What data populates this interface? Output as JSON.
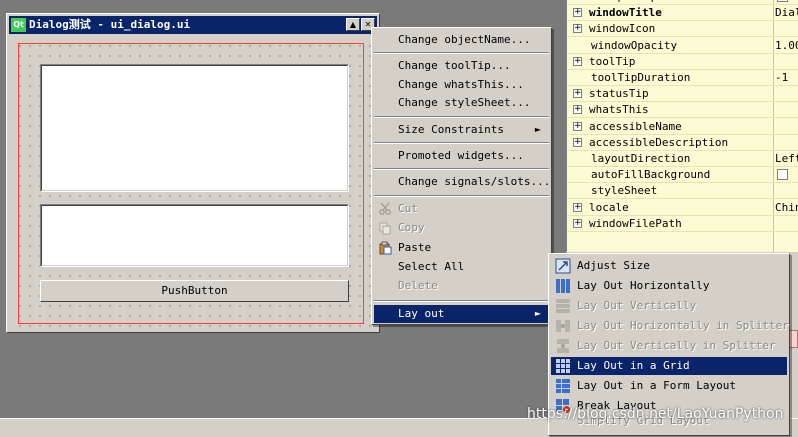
{
  "dialog": {
    "title": "Dialog测试 - ui_dialog.ui",
    "logo": "Qt",
    "minimize_glyph": "▲",
    "close_glyph": "✕",
    "push_button_label": "PushButton"
  },
  "properties": {
    "rows": [
      {
        "name": "acceptDrops",
        "value": "",
        "checkbox": true,
        "expand": false,
        "bold": false
      },
      {
        "name": "windowTitle",
        "value": "Dial",
        "checkbox": false,
        "expand": true,
        "bold": true
      },
      {
        "name": "windowIcon",
        "value": "",
        "checkbox": false,
        "expand": true,
        "bold": false
      },
      {
        "name": "windowOpacity",
        "value": "1.00",
        "checkbox": false,
        "expand": false,
        "bold": false
      },
      {
        "name": "toolTip",
        "value": "",
        "checkbox": false,
        "expand": true,
        "bold": false
      },
      {
        "name": "toolTipDuration",
        "value": "-1",
        "checkbox": false,
        "expand": false,
        "bold": false
      },
      {
        "name": "statusTip",
        "value": "",
        "checkbox": false,
        "expand": true,
        "bold": false
      },
      {
        "name": "whatsThis",
        "value": "",
        "checkbox": false,
        "expand": true,
        "bold": false
      },
      {
        "name": "accessibleName",
        "value": "",
        "checkbox": false,
        "expand": true,
        "bold": false
      },
      {
        "name": "accessibleDescription",
        "value": "",
        "checkbox": false,
        "expand": true,
        "bold": false
      },
      {
        "name": "layoutDirection",
        "value": "Left",
        "checkbox": false,
        "expand": false,
        "bold": false
      },
      {
        "name": "autoFillBackground",
        "value": "",
        "checkbox": true,
        "expand": false,
        "bold": false
      },
      {
        "name": "styleSheet",
        "value": "",
        "checkbox": false,
        "expand": false,
        "bold": false
      },
      {
        "name": "locale",
        "value": "Chin",
        "checkbox": false,
        "expand": true,
        "bold": false
      },
      {
        "name": "windowFilePath",
        "value": "",
        "checkbox": false,
        "expand": true,
        "bold": false
      }
    ]
  },
  "context_menu": {
    "items": [
      {
        "label": "Change objectName...",
        "type": "item"
      },
      {
        "type": "sep"
      },
      {
        "label": "Change toolTip...",
        "type": "item"
      },
      {
        "label": "Change whatsThis...",
        "type": "item"
      },
      {
        "label": "Change styleSheet...",
        "type": "item"
      },
      {
        "type": "sep"
      },
      {
        "label": "Size Constraints",
        "type": "item",
        "submenu": true
      },
      {
        "type": "sep"
      },
      {
        "label": "Promoted widgets...",
        "type": "item"
      },
      {
        "type": "sep"
      },
      {
        "label": "Change signals/slots...",
        "type": "item"
      },
      {
        "type": "sep"
      },
      {
        "label": "Cut",
        "type": "item",
        "disabled": true,
        "icon": "scissors-icon"
      },
      {
        "label": "Copy",
        "type": "item",
        "disabled": true,
        "icon": "copy-icon"
      },
      {
        "label": "Paste",
        "type": "item",
        "icon": "paste-icon"
      },
      {
        "label": "Select All",
        "type": "item"
      },
      {
        "label": "Delete",
        "type": "item",
        "disabled": true
      },
      {
        "type": "sep"
      },
      {
        "label": "Lay out",
        "type": "item",
        "submenu": true,
        "selected": true
      }
    ],
    "submenu_arrow": "►"
  },
  "layout_submenu": {
    "items": [
      {
        "label": "Adjust Size",
        "icon": "adjust-size-icon"
      },
      {
        "label": "Lay Out Horizontally",
        "icon": "layout-horizontal-icon"
      },
      {
        "label": "Lay Out Vertically",
        "icon": "layout-vertical-icon",
        "disabled": true
      },
      {
        "label": "Lay Out Horizontally in Splitter",
        "icon": "splitter-horizontal-icon",
        "disabled": true
      },
      {
        "label": "Lay Out Vertically in Splitter",
        "icon": "splitter-vertical-icon",
        "disabled": true
      },
      {
        "label": "Lay Out in a Grid",
        "icon": "layout-grid-icon",
        "selected": true
      },
      {
        "label": "Lay Out in a Form Layout",
        "icon": "layout-form-icon"
      },
      {
        "label": "Break Layout",
        "icon": "break-layout-icon"
      },
      {
        "label": "Simplify Grid Layout",
        "disabled": true
      }
    ]
  },
  "watermark": "https://blog.csdn.net/LaoYuanPython",
  "colors": {
    "highlight": "#0a246a",
    "property_bg": "#fdfbd4",
    "layout_red": "#ff3a3a"
  }
}
